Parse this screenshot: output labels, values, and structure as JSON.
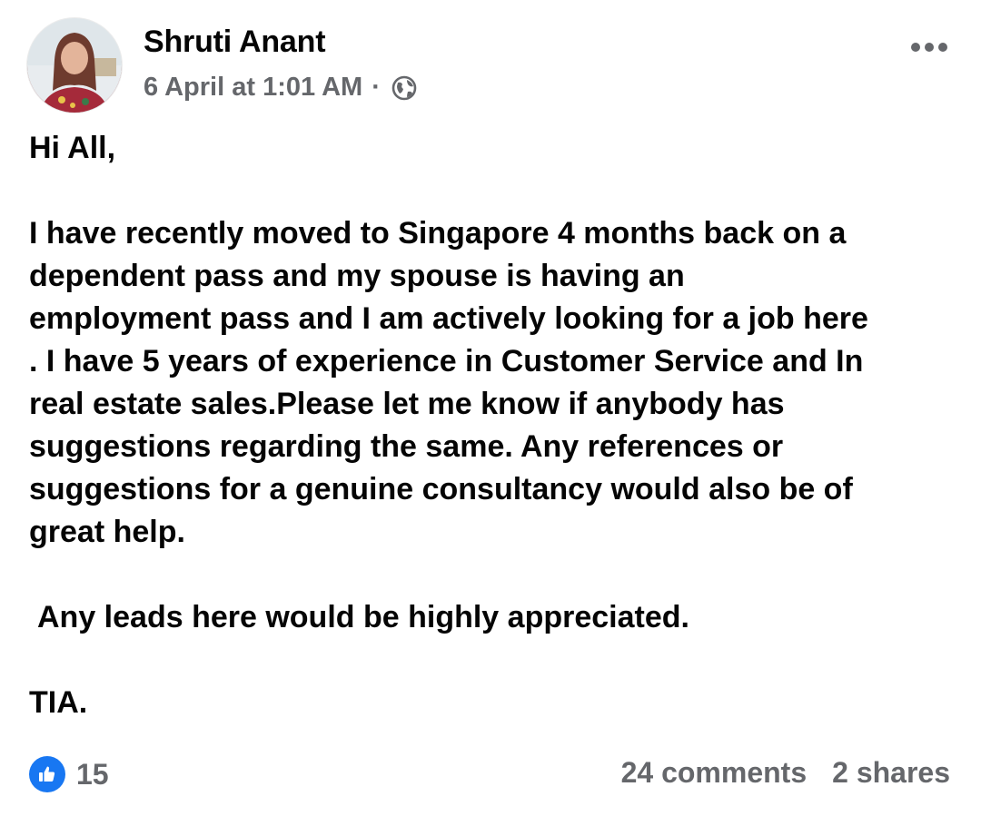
{
  "post": {
    "author": "Shruti Anant",
    "timestamp": "6 April at 1:01 AM",
    "separator": "·",
    "privacy_icon": "globe-icon",
    "menu_icon": "more-options-icon",
    "body": {
      "greeting": "Hi All,",
      "paragraph_lines": [
        "I have recently moved to Singapore 4 months back  on a",
        "dependent pass and my spouse is having an",
        "employment pass and I am actively looking for a job here",
        ". I have 5 years of experience in Customer Service and In",
        "real estate sales.Please let me know if anybody has",
        "suggestions regarding the same. Any references or",
        "suggestions for a genuine consultancy would also be of",
        "great help."
      ],
      "closing_request": "Any leads here would be highly appreciated.",
      "sign_off": "TIA."
    },
    "reactions": {
      "icon": "like-icon",
      "count": "15"
    },
    "comments": "24 comments",
    "shares": "2 shares"
  },
  "colors": {
    "like_blue": "#1877f2",
    "secondary_text": "#65676b",
    "primary_text": "#050505"
  }
}
